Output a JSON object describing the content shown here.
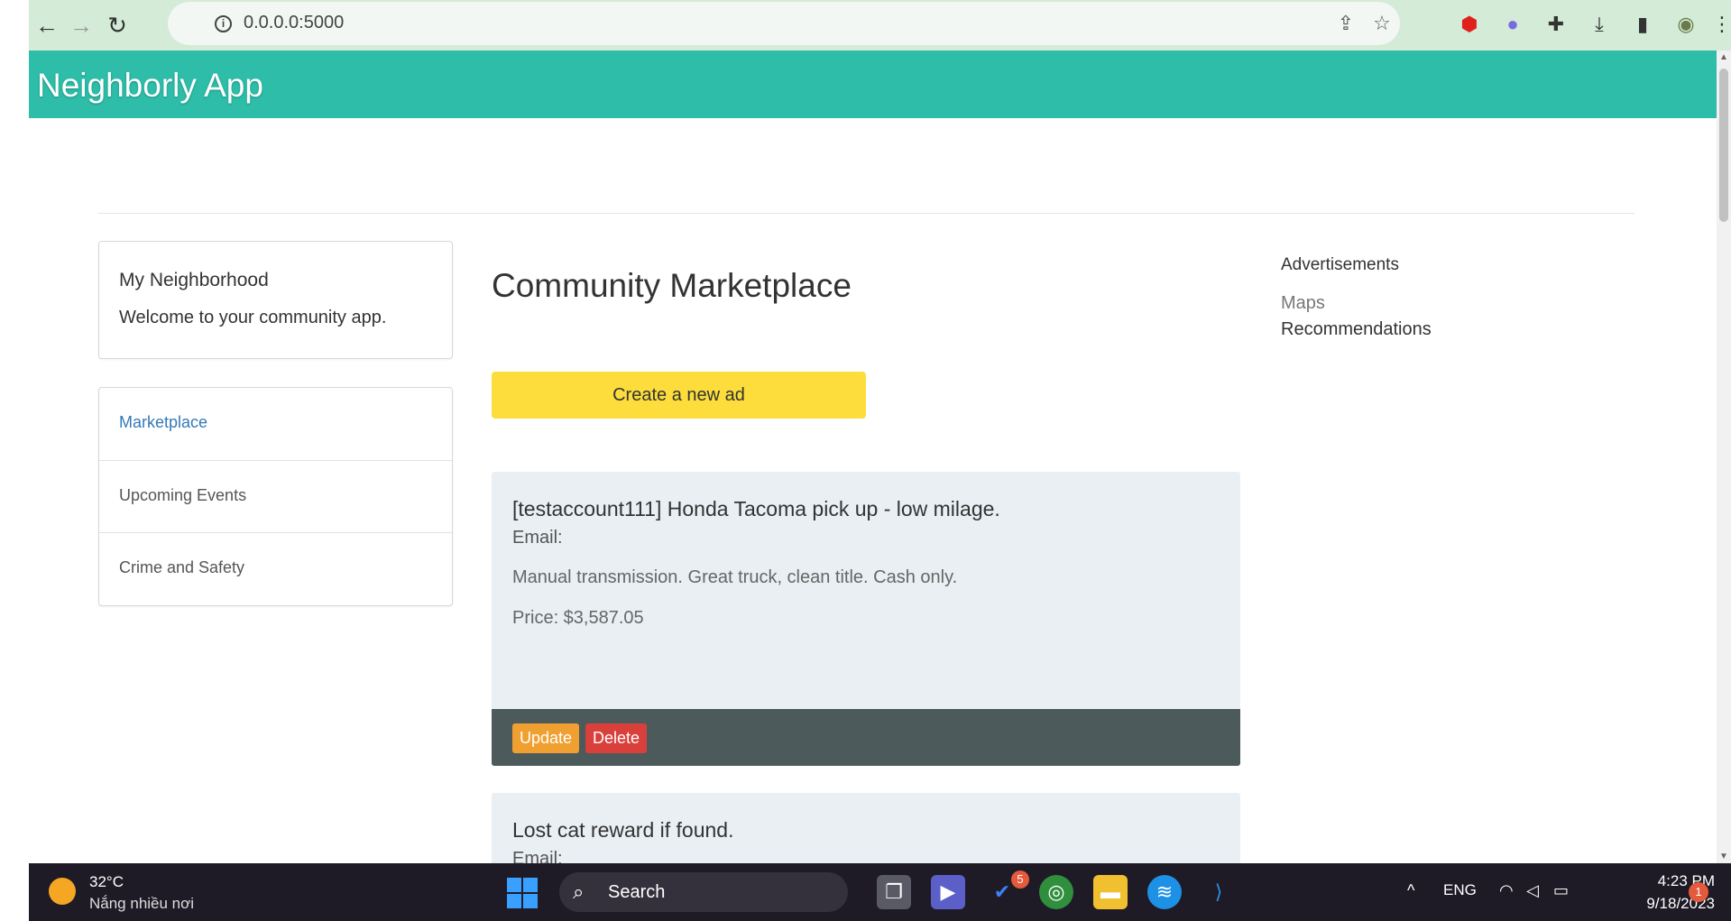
{
  "browser": {
    "url": "0.0.0.0:5000",
    "back_icon": "←",
    "forward_icon": "→",
    "reload_icon": "↻",
    "share_icon": "⇪",
    "star_icon": "☆",
    "ext_icons": [
      "⬢",
      "●",
      "✚",
      "⤓",
      "▮",
      "◉",
      "⋮"
    ]
  },
  "app": {
    "title": "Neighborly App",
    "theme_color": "#2dbda8"
  },
  "sidebar": {
    "card_title": "My Neighborhood",
    "card_text": "Welcome to your community app.",
    "nav": [
      "Marketplace",
      "Upcoming Events",
      "Crime and Safety"
    ]
  },
  "main": {
    "heading": "Community Marketplace",
    "create_button": "Create a new ad",
    "ads": [
      {
        "title": "[testaccount111] Honda Tacoma pick up - low milage.",
        "email": "Email:",
        "description": "Manual transmission. Great truck, clean title. Cash only.",
        "price": "Price: $3,587.05",
        "update_label": "Update",
        "delete_label": "Delete"
      },
      {
        "title": "Lost cat reward if found.",
        "email": "Email:"
      }
    ]
  },
  "aside": {
    "heading": "Advertisements",
    "links": [
      "Maps",
      "Recommendations"
    ]
  },
  "taskbar": {
    "temperature": "32°C",
    "weather_text": "Nắng nhiều nơi",
    "search_label": "Search",
    "todo_badge": "5",
    "tray_chevron": "^",
    "language": "ENG",
    "time": "4:23 PM",
    "date": "9/18/2023",
    "notification_count": "1"
  }
}
